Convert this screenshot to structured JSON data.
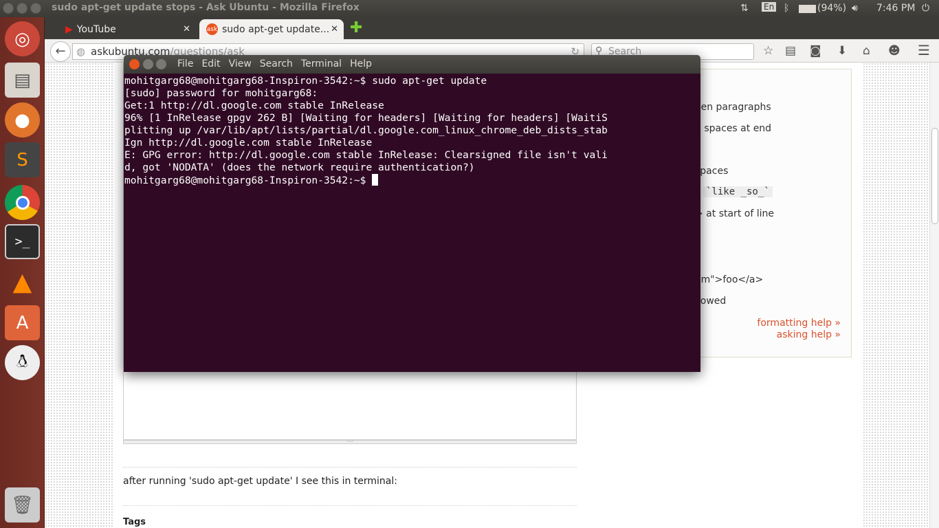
{
  "topbar": {
    "title": "sudo apt-get update stops - Ask Ubuntu - Mozilla Firefox",
    "keyboard": "En",
    "battery": "(94%)",
    "time": "7:46 PM"
  },
  "launcher": [
    {
      "icon": "ubuntu-dash-icon"
    },
    {
      "icon": "files-icon"
    },
    {
      "icon": "firefox-icon"
    },
    {
      "icon": "sublime-text-icon"
    },
    {
      "icon": "chrome-icon"
    },
    {
      "icon": "terminal-icon"
    },
    {
      "icon": "vlc-icon"
    },
    {
      "icon": "software-center-icon"
    },
    {
      "icon": "penguin-icon"
    },
    {
      "icon": "trash-icon"
    }
  ],
  "tabs": [
    {
      "label": "YouTube",
      "icon": "youtube-icon"
    },
    {
      "label": "sudo apt-get update...",
      "icon": "askubuntu-icon",
      "active": true
    }
  ],
  "nav": {
    "url_host": "askubuntu.com",
    "url_path": "/questions/ask",
    "search_placeholder": "Search"
  },
  "page": {
    "preview": "after running 'sudo apt-get update' I see this in terminal:",
    "tags_label": "Tags",
    "help_items": [
      "een paragraphs",
      "2 spaces at end",
      "*",
      "spaces",
      "`like _so_`",
      "> at start of line",
      ")",
      "om\">foo</a>",
      "llowed"
    ],
    "formatting_help": "formatting help »",
    "asking_help": "asking help »"
  },
  "terminal": {
    "menu": [
      "File",
      "Edit",
      "View",
      "Search",
      "Terminal",
      "Help"
    ],
    "lines": [
      "mohitgarg68@mohitgarg68-Inspiron-3542:~$ sudo apt-get update",
      "[sudo] password for mohitgarg68:",
      "Get:1 http://dl.google.com stable InRelease",
      "96% [1 InRelease gpgv 262 B] [Waiting for headers] [Waiting for headers] [WaitiS",
      "plitting up /var/lib/apt/lists/partial/dl.google.com_linux_chrome_deb_dists_stab",
      "Ign http://dl.google.com stable InRelease",
      "E: GPG error: http://dl.google.com stable InRelease: Clearsigned file isn't vali",
      "d, got 'NODATA' (does the network require authentication?)"
    ],
    "prompt": "mohitgarg68@mohitgarg68-Inspiron-3542:~$ "
  },
  "colors": {
    "terminal_bg": "#300a24",
    "link": "#d9512c",
    "launcher": "#6b2a22"
  }
}
